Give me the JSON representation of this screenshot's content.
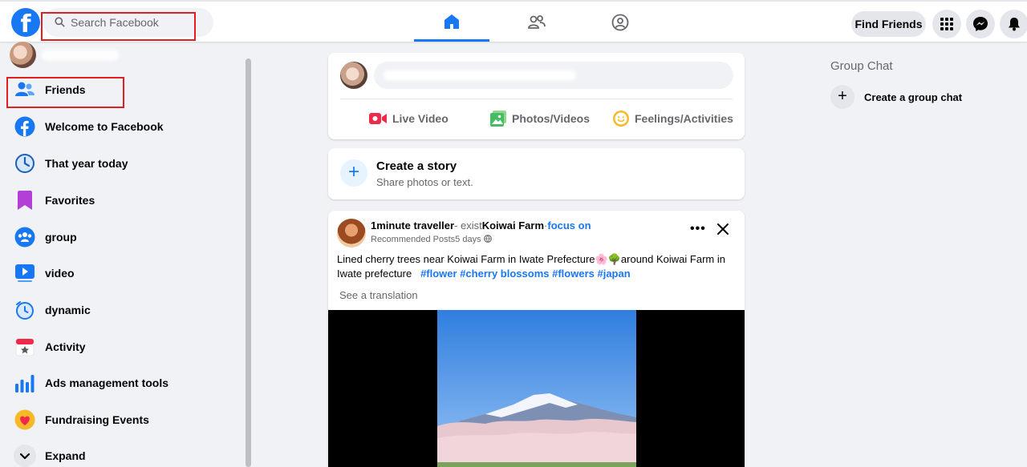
{
  "header": {
    "search_placeholder": "Search Facebook",
    "find_friends": "Find Friends",
    "logo_letter": "f"
  },
  "sidebar": {
    "items": [
      {
        "label": "Friends",
        "icon": "friends-icon"
      },
      {
        "label": "Welcome to Facebook",
        "icon": "facebook-icon"
      },
      {
        "label": "That year today",
        "icon": "memories-clock-icon"
      },
      {
        "label": "Favorites",
        "icon": "bookmark-icon"
      },
      {
        "label": "group",
        "icon": "groups-icon"
      },
      {
        "label": "video",
        "icon": "video-icon"
      },
      {
        "label": "dynamic",
        "icon": "feeds-icon"
      },
      {
        "label": "Activity",
        "icon": "events-icon"
      },
      {
        "label": "Ads management tools",
        "icon": "bar-chart-icon"
      },
      {
        "label": "Fundraising Events",
        "icon": "heart-icon"
      },
      {
        "label": "Expand",
        "icon": "chevron-down-icon"
      }
    ]
  },
  "composer": {
    "live_video": "Live Video",
    "photos_videos": "Photos/Videos",
    "feelings": "Feelings/Activities"
  },
  "story": {
    "title": "Create a story",
    "subtitle": "Share photos or text."
  },
  "post": {
    "author": "1minute traveller",
    "separator": "- exist",
    "place": "Koiwai Farm",
    "dot": "·",
    "follow": "focus on",
    "meta_prefix": "Recommended Posts",
    "meta_time": "5 days",
    "text": "Lined cherry trees near Koiwai Farm in Iwate Prefecture🌸🌳around Koiwai Farm in Iwate prefecture",
    "tags": [
      "#flower",
      "#cherry blossoms",
      "#flowers",
      "#japan"
    ],
    "see_translation": "See a translation"
  },
  "right": {
    "title": "Group Chat",
    "create_group_chat": "Create a group chat"
  },
  "colors": {
    "brand": "#1877f2",
    "annotation_box": "#e02020"
  }
}
